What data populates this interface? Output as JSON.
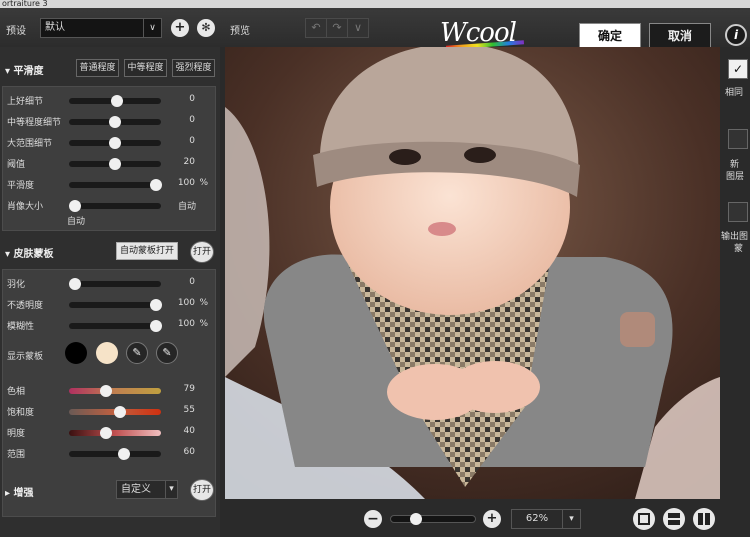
{
  "window": {
    "title": "ortraiture 3"
  },
  "header": {
    "preset_label": "预设",
    "preset_value": "默认",
    "preview_label": "预览",
    "undo_icons": [
      "↶",
      "↷",
      "∨"
    ],
    "logo_text": "Wcool",
    "ok_label": "确定",
    "cancel_label": "取消",
    "info_label": "i"
  },
  "smoothing": {
    "title": "平滑度",
    "presets": [
      "普通程度",
      "中等程度",
      "强烈程度"
    ],
    "sliders": [
      {
        "label": "上好细节",
        "value": "0",
        "pos": 0.52
      },
      {
        "label": "中等程度细节",
        "value": "0",
        "pos": 0.5
      },
      {
        "label": "大范围细节",
        "value": "0",
        "pos": 0.5
      },
      {
        "label": "阈值",
        "value": "20",
        "pos": 0.5
      },
      {
        "label": "平滑度",
        "value": "100",
        "unit": "%",
        "pos": 0.95
      },
      {
        "label": "肖像大小",
        "value": "自动",
        "pos": 0.06
      }
    ],
    "auto_label": "自动"
  },
  "skin_mask": {
    "title": "皮肤蒙板",
    "auto_mask_label": "自动蒙板打开",
    "open_label": "打开",
    "sliders": [
      {
        "label": "羽化",
        "value": "0",
        "pos": 0.06
      },
      {
        "label": "不透明度",
        "value": "100",
        "unit": "%",
        "pos": 0.95
      },
      {
        "label": "模糊性",
        "value": "100",
        "unit": "%",
        "pos": 0.95
      }
    ],
    "show_mask_label": "显示蒙板",
    "swatch_colors": [
      "#000000",
      "#f6e3c8"
    ],
    "color_sliders": [
      {
        "label": "色相",
        "value": "79",
        "pos": 0.4,
        "gradient": "linear-gradient(90deg,#b03060,#c08050,#c0a040)"
      },
      {
        "label": "饱和度",
        "value": "55",
        "pos": 0.55,
        "gradient": "linear-gradient(90deg,#6a5a55,#c06040,#d03010)"
      },
      {
        "label": "明度",
        "value": "40",
        "pos": 0.4,
        "gradient": "linear-gradient(90deg,#3a1010,#c05050,#f0c0c0)"
      },
      {
        "label": "范围",
        "value": "60",
        "pos": 0.6,
        "gradient": "linear-gradient(90deg,#1a1a1a,#1a1a1a)"
      }
    ]
  },
  "enhance": {
    "title": "增强",
    "select_value": "自定义",
    "open_label": "打开"
  },
  "right_panel": {
    "same_label": "相同",
    "new_layer_label_1": "新",
    "new_layer_label_2": "图层",
    "output_label_1": "输出图",
    "output_label_2": "蒙",
    "checkmark": "✓"
  },
  "bottom": {
    "zoom_value": "62%",
    "zoom_slider_pos": 0.3
  }
}
